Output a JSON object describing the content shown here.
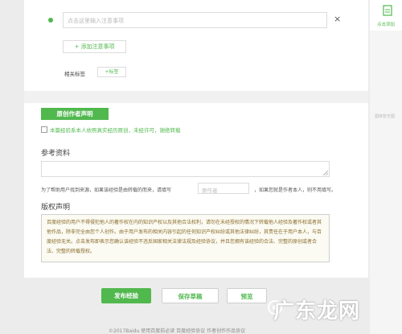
{
  "notes": {
    "placeholder": "点击这里输入注意事项",
    "add_button": "+ 添加注意事项",
    "close_symbol": "×"
  },
  "tags": {
    "label": "相关标签",
    "add_button": "+标签"
  },
  "original": {
    "button": "原创作者声明",
    "checkbox_text": "本篇经验系本人依照真实经历原创，未经许可，谢绝转载"
  },
  "reference": {
    "title": "参考资料"
  },
  "author": {
    "text_before": "为了帮助用户找到来源，如果该经验是由转载的而来，请填写",
    "input_placeholder": "原作者",
    "text_after": "，如果您就是作者本人，则不用填写。"
  },
  "copyright": {
    "title": "版权声明",
    "body": "百度经验的用户不得侵犯他人的著作权在内的知识产权以及其他合法权利，请勿在未经授权的情况下转载他人经验及著作权或者其他作品，除非完全由您个人创作。由于用户发布的相关内容引起的任何知识产权纠纷或其他法律纠纷，其责任在于用户本人，与百度经验无关。点击发布即表示您确认该经验不违反国家相关法律法规及经验协议，并且您拥有该经验的合法、完整的原创或者合法、完整的转载授权。"
  },
  "actions": {
    "publish": "发布经验",
    "save_draft": "保存草稿",
    "preview": "预览"
  },
  "footer": {
    "text": "©2017Baidu  使用百度前必读  百度经验协议  作者创作作品协议"
  },
  "sidebar": {
    "add_label": "点击添加",
    "note": "图库暂无图"
  },
  "watermark": {
    "text": "广东龙网"
  },
  "colors": {
    "accent": "#51b84e",
    "background": "#ececec"
  }
}
